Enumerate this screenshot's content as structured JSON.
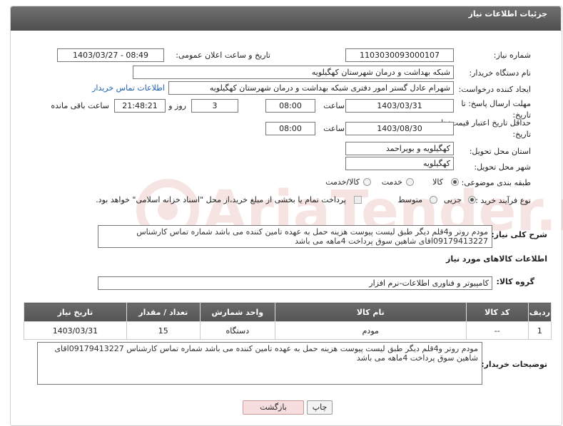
{
  "header": {
    "title": "جزئیات اطلاعات نیاز"
  },
  "form": {
    "need_number": {
      "label": "شماره نیاز:",
      "value": "1103030093000107"
    },
    "announce_datetime": {
      "label": "تاریخ و ساعت اعلان عمومی:",
      "value": "1403/03/27 - 08:49"
    },
    "buyer_org": {
      "label": "نام دستگاه خریدار:",
      "value": "شبکه بهداشت و درمان شهرستان کهگیلویه"
    },
    "requester": {
      "label": "ایجاد کننده درخواست:",
      "value": "شهرام عادل گستر امور دفتری شبکه بهداشت و درمان شهرستان کهگیلویه",
      "contact_link": "اطلاعات تماس خریدار"
    },
    "reply_deadline": {
      "label": "مهلت ارسال پاسخ: تا تاریخ:",
      "date": "1403/03/31",
      "time_label": "ساعت",
      "time": "08:00",
      "days": "3",
      "days_label": "روز و",
      "remaining": "21:48:21",
      "remaining_label": "ساعت باقی مانده"
    },
    "price_validity": {
      "label": "حداقل تاریخ اعتبار قیمت: تا تاریخ:",
      "date": "1403/08/30",
      "time_label": "ساعت",
      "time": "08:00"
    },
    "delivery_province": {
      "label": "استان محل تحویل:",
      "value": "کهگیلویه و بویراحمد"
    },
    "delivery_city": {
      "label": "شهر محل تحویل:",
      "value": "کهگیلویه"
    },
    "category": {
      "label": "طبقه بندی موضوعی:",
      "options": [
        "کالا",
        "خدمت",
        "کالا/خدمت"
      ],
      "selected": "کالا"
    },
    "process_type": {
      "label": "نوع فرآیند خرید :",
      "options": [
        "جزیی",
        "متوسط"
      ],
      "selected": "جزیی",
      "payment_text": "پرداخت تمام یا بخشی از مبلغ خرید،از محل \"اسناد خزانه اسلامی\" خواهد بود."
    },
    "general_desc": {
      "label": "شرح کلی نیاز:",
      "value": "مودم روتر  و4قلم دیگر طبق لیست پیوست هزینه حمل به عهده تامین کننده می باشد شماره تماس کارشناس 09179413227اقای شاهین سوق پرداخت 4ماهه می باشد"
    }
  },
  "goods": {
    "section_title": "اطلاعات کالاهای مورد نیاز",
    "group_label": "گروه کالا:",
    "group_value": "کامپیوتر و فناوری اطلاعات-نرم افزار",
    "columns": [
      "ردیف",
      "کد کالا",
      "نام کالا",
      "واحد شمارش",
      "تعداد / مقدار",
      "تاریخ نیاز"
    ],
    "rows": [
      {
        "index": "1",
        "code": "--",
        "name": "مودم",
        "unit": "دستگاه",
        "qty": "15",
        "date": "1403/03/31"
      }
    ]
  },
  "buyer_notes": {
    "label": "توضیحات خریدار:",
    "value": "مودم روتر  و4قلم دیگر طبق لیست پیوست هزینه حمل به عهده تامین کننده می باشد شماره تماس کارشناس 09179413227اقای شاهین سوق پرداخت 4ماهه می باشد"
  },
  "buttons": {
    "print": "چاپ",
    "back": "بازگشت"
  },
  "watermark": {
    "text": "AriaTender.neT"
  },
  "colors": {
    "header_bg": "#5a5a5a",
    "link": "#1a5fb4",
    "back_btn_bg": "#f6dede",
    "watermark": "#c0392b"
  }
}
